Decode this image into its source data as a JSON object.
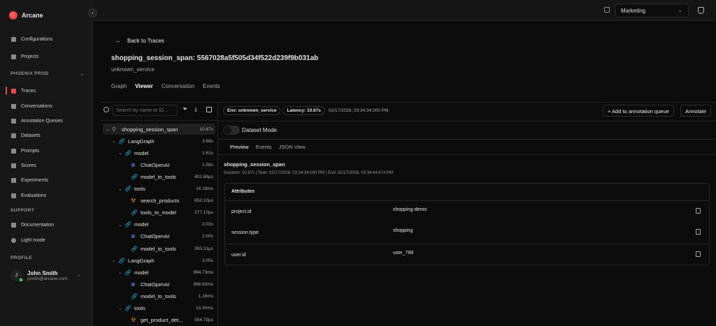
{
  "app": {
    "name": "Arcane"
  },
  "sidebar": {
    "items": [
      {
        "label": "Configurations"
      },
      {
        "label": "Projects"
      }
    ],
    "section_project": "PHOENIX PROD",
    "project_items": [
      {
        "label": "Traces",
        "active": true
      },
      {
        "label": "Conversations"
      },
      {
        "label": "Annotation Queues"
      },
      {
        "label": "Datasets"
      },
      {
        "label": "Prompts"
      },
      {
        "label": "Scores"
      },
      {
        "label": "Experiments"
      },
      {
        "label": "Evaluations"
      }
    ],
    "section_support": "SUPPORT",
    "support_items": [
      {
        "label": "Documentation"
      },
      {
        "label": "Light mode"
      }
    ],
    "section_profile": "PROFILE",
    "profile": {
      "initial": "J",
      "name": "John Smith",
      "email": "jsmith@arcane.com"
    }
  },
  "topbar": {
    "org": "Marketing"
  },
  "header": {
    "back": "Back to Traces",
    "title": "shopping_session_span: 5567028a5f505d34f522d239f9b031ab",
    "service": "unknown_service",
    "tabs": [
      "Graph",
      "Viewer",
      "Conversation",
      "Events"
    ],
    "active_tab": "Viewer"
  },
  "tree": {
    "search_placeholder": "Search by name or ID...",
    "rows": [
      {
        "name": "shopping_session_span",
        "dur": "10.67s",
        "level": 0,
        "kind": "root",
        "chev": true
      },
      {
        "name": "LangGraph",
        "dur": "3.68s",
        "level": 1,
        "kind": "chain",
        "chev": true
      },
      {
        "name": "model",
        "dur": "1.61s",
        "level": 2,
        "kind": "chain",
        "chev": true
      },
      {
        "name": "ChatOpenAI",
        "dur": "1.58s",
        "level": 3,
        "kind": "llm"
      },
      {
        "name": "model_to_tools",
        "dur": "401.86µs",
        "level": 3,
        "kind": "chain"
      },
      {
        "name": "tools",
        "dur": "14.18ms",
        "level": 2,
        "kind": "chain",
        "chev": true
      },
      {
        "name": "search_products",
        "dur": "652.10µs",
        "level": 3,
        "kind": "tool"
      },
      {
        "name": "tools_to_model",
        "dur": "277.10µs",
        "level": 3,
        "kind": "chain"
      },
      {
        "name": "model",
        "dur": "2.02s",
        "level": 2,
        "kind": "chain",
        "chev": true
      },
      {
        "name": "ChatOpenAI",
        "dur": "2.00s",
        "level": 3,
        "kind": "llm"
      },
      {
        "name": "model_to_tools",
        "dur": "393.31µs",
        "level": 3,
        "kind": "chain"
      },
      {
        "name": "LangGraph",
        "dur": "3.05s",
        "level": 1,
        "kind": "chain",
        "chev": true
      },
      {
        "name": "model",
        "dur": "994.73ms",
        "level": 2,
        "kind": "chain",
        "chev": true
      },
      {
        "name": "ChatOpenAI",
        "dur": "968.83ms",
        "level": 3,
        "kind": "llm"
      },
      {
        "name": "model_to_tools",
        "dur": "1.16ms",
        "level": 3,
        "kind": "chain"
      },
      {
        "name": "tools",
        "dur": "13.30ms",
        "level": 2,
        "kind": "chain",
        "chev": true
      },
      {
        "name": "get_product_det...",
        "dur": "554.79µs",
        "level": 3,
        "kind": "tool"
      }
    ]
  },
  "detail": {
    "env": "Env: unknown_service",
    "latency": "Latency: 10.67s",
    "timestamp": "02/17/2026, 03:34:34.000 PM",
    "add_queue": "+ Add to annotation queue",
    "annotate": "Annotate",
    "dataset_mode": "Dataset Mode",
    "tabs": [
      "Preview",
      "Events",
      "JSON View"
    ],
    "span_name": "shopping_session_span",
    "meta": "Duration: 10.67s | Start: 02/17/2026, 03:34:34.000 PM | End: 02/17/2026, 03:34:44.674 PM",
    "attributes_title": "Attributes",
    "attributes": [
      {
        "key": "project.id",
        "value": "shopping-demo"
      },
      {
        "key": "session.type",
        "value": "shopping"
      },
      {
        "key": "user.id",
        "value": "user_789"
      }
    ]
  },
  "colors": {
    "accent": "#e5484d",
    "chain": "#3fb6d8",
    "llm": "#6b8cff",
    "tool": "#e08a2c"
  }
}
